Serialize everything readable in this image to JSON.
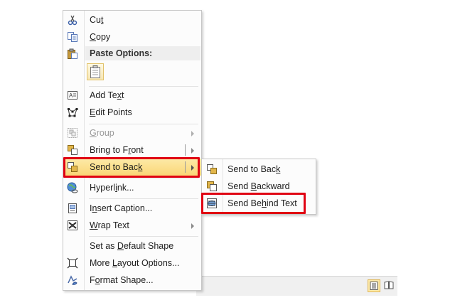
{
  "context_menu": {
    "items": [
      {
        "pre": "Cu",
        "acc": "t",
        "post": ""
      },
      {
        "pre": "",
        "acc": "C",
        "post": "opy"
      },
      {
        "header": "Paste Options:"
      },
      {
        "pre": "Add Te",
        "acc": "x",
        "post": "t"
      },
      {
        "pre": "",
        "acc": "E",
        "post": "dit Points"
      },
      {
        "pre": "",
        "acc": "G",
        "post": "roup"
      },
      {
        "pre": "Bring to F",
        "acc": "r",
        "post": "ont"
      },
      {
        "pre": "Send to Bac",
        "acc": "k",
        "post": ""
      },
      {
        "pre": "Hyperl",
        "acc": "i",
        "post": "nk..."
      },
      {
        "pre": "I",
        "acc": "n",
        "post": "sert Caption..."
      },
      {
        "pre": "",
        "acc": "W",
        "post": "rap Text"
      },
      {
        "pre": "Set as ",
        "acc": "D",
        "post": "efault Shape"
      },
      {
        "pre": "More ",
        "acc": "L",
        "post": "ayout Options..."
      },
      {
        "pre": "F",
        "acc": "o",
        "post": "rmat Shape..."
      }
    ]
  },
  "submenu": {
    "items": [
      {
        "pre": "Send to Bac",
        "acc": "k",
        "post": ""
      },
      {
        "pre": "Send ",
        "acc": "B",
        "post": "ackward"
      },
      {
        "pre": "Send Be",
        "acc": "h",
        "post": "ind Text"
      }
    ]
  },
  "colors": {
    "highlight_border": "#e00012",
    "hover_fill": "#fad676"
  }
}
